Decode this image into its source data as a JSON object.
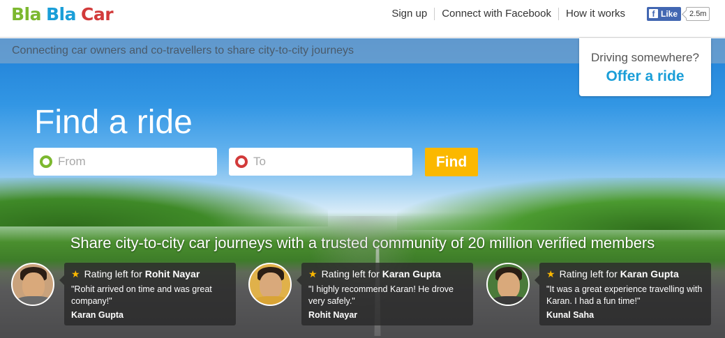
{
  "header": {
    "logo": {
      "part1": "Bla",
      "part2": "Bla",
      "part3": "Car",
      "color1": "#7cb82f",
      "color2": "#1a9ed8",
      "color3": "#d23a3a"
    },
    "nav": [
      {
        "label": "Sign up"
      },
      {
        "label": "Connect with Facebook"
      },
      {
        "label": "How it works"
      }
    ],
    "facebook": {
      "like_label": "Like",
      "count": "2.5m",
      "icon": "f"
    }
  },
  "hero": {
    "tagline": "Connecting car owners and co-travellers to share city-to-city journeys",
    "offer": {
      "question": "Driving somewhere?",
      "link_label": "Offer a ride"
    },
    "title": "Find a ride",
    "search": {
      "from_placeholder": "From",
      "to_placeholder": "To",
      "find_label": "Find"
    },
    "share_text": "Share city-to-city car journeys with a trusted community of 20 million verified members"
  },
  "reviews": [
    {
      "prefix": "Rating left for",
      "name": "Rohit Nayar",
      "quote": "\"Rohit arrived on time and was great company!\"",
      "author": "Karan Gupta"
    },
    {
      "prefix": "Rating left for",
      "name": "Karan Gupta",
      "quote": "\"I highly recommend Karan! He drove very safely.\"",
      "author": "Rohit Nayar"
    },
    {
      "prefix": "Rating left for",
      "name": "Karan Gupta",
      "quote": "\"It was a great experience travelling with Karan. I had a fun time!\"",
      "author": "Kunal Saha"
    }
  ],
  "colors": {
    "accent_blue": "#1a9ed8",
    "find_button": "#fbb800",
    "star": "#fbb800",
    "facebook": "#4267b2"
  }
}
